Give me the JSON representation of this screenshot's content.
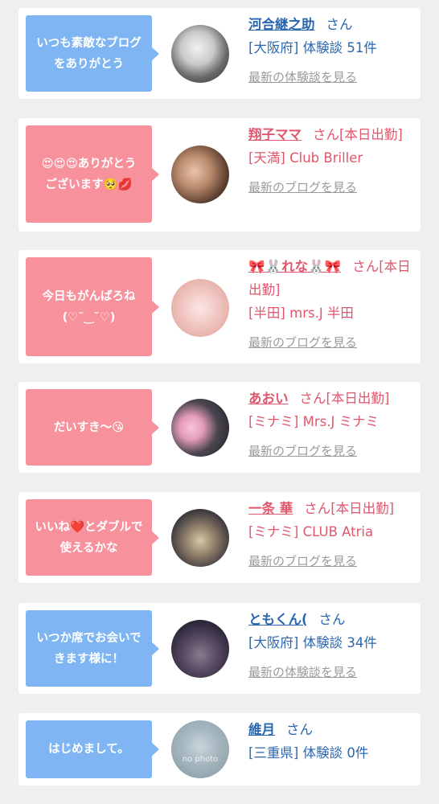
{
  "items": [
    {
      "message": "いつも素敵なブログをありがとう",
      "name": "河合継之助",
      "suffix": "さん",
      "sub": "[大阪府] 体験談 51件",
      "link": "最新の体験談を見る"
    },
    {
      "message": "😍😍😍ありがとうございます🥺💋",
      "name": "翔子ママ",
      "suffix": "さん[本日出勤]",
      "sub": "[天満] Club Briller",
      "link": "最新のブログを見る"
    },
    {
      "message": "今日もがんばろね(♡˘‿˘♡)",
      "name": "🎀🐰れな🐰🎀",
      "suffix": "さん[本日出勤]",
      "sub": "[半田] mrs.J 半田",
      "link": "最新のブログを見る"
    },
    {
      "message": "だいすき〜😘",
      "name": "あおい",
      "suffix": "さん[本日出勤]",
      "sub": "[ミナミ] Mrs.J ミナミ",
      "link": "最新のブログを見る"
    },
    {
      "message": "いいね❤️とダブルで使えるかな",
      "name": "一条 華",
      "suffix": "さん[本日出勤]",
      "sub": "[ミナミ] CLUB Atria",
      "link": "最新のブログを見る"
    },
    {
      "message": "いつか席でお会いできます様に！",
      "name": "ともくん(",
      "suffix": "さん",
      "sub": "[大阪府] 体験談 34件",
      "link": "最新の体験談を見る"
    },
    {
      "message": "はじめまして。",
      "name": "維月",
      "suffix": "さん",
      "sub": "[三重県] 体験談 0件",
      "avatar_text": "no photo"
    }
  ],
  "colors": {
    "blue_bubble": "#7fb5f2",
    "pink_bubble": "#f7919c",
    "blue_text": "#2a67b2",
    "pink_text": "#e0566c",
    "link_gray": "#9a9a9a",
    "background": "#efefef"
  }
}
